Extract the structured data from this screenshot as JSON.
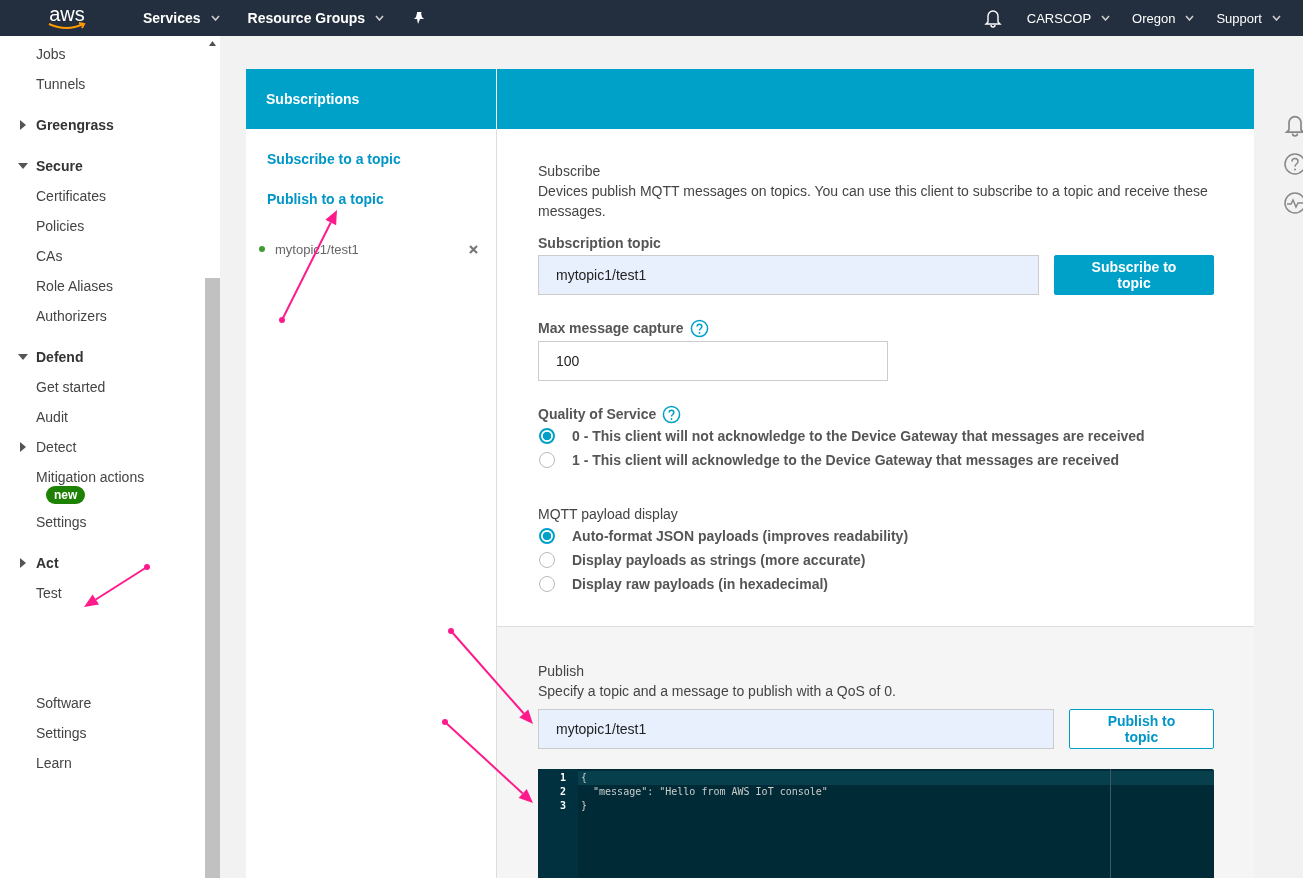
{
  "header": {
    "logo": "aws",
    "menus": [
      {
        "label": "Services"
      },
      {
        "label": "Resource Groups"
      }
    ],
    "account_menus": [
      {
        "label": "CARSCOP"
      },
      {
        "label": "Oregon"
      },
      {
        "label": "Support"
      }
    ]
  },
  "sidebar": {
    "items": [
      {
        "kind": "link",
        "label": "Jobs"
      },
      {
        "kind": "link",
        "label": "Tunnels"
      },
      {
        "kind": "section",
        "label": "Greengrass",
        "expanded": false
      },
      {
        "kind": "section",
        "label": "Secure",
        "expanded": true
      },
      {
        "kind": "link",
        "label": "Certificates"
      },
      {
        "kind": "link",
        "label": "Policies"
      },
      {
        "kind": "link",
        "label": "CAs"
      },
      {
        "kind": "link",
        "label": "Role Aliases"
      },
      {
        "kind": "link",
        "label": "Authorizers"
      },
      {
        "kind": "section",
        "label": "Defend",
        "expanded": true
      },
      {
        "kind": "link",
        "label": "Get started"
      },
      {
        "kind": "link",
        "label": "Audit"
      },
      {
        "kind": "group",
        "label": "Detect",
        "expanded": false
      },
      {
        "kind": "link",
        "label": "Mitigation actions",
        "badge": "new"
      },
      {
        "kind": "link",
        "label": "Settings"
      },
      {
        "kind": "section",
        "label": "Act",
        "expanded": false
      },
      {
        "kind": "link",
        "label": "Test"
      }
    ],
    "footer_items": [
      {
        "label": "Software"
      },
      {
        "label": "Settings"
      },
      {
        "label": "Learn"
      }
    ]
  },
  "panel": {
    "title": "Subscriptions",
    "links": [
      "Subscribe to a topic",
      "Publish to a topic"
    ],
    "subscriptions": [
      {
        "topic": "mytopic1/test1",
        "color": "#3f9c35"
      }
    ]
  },
  "subscribe": {
    "title": "Subscribe",
    "description": "Devices publish MQTT messages on topics. You can use this client to subscribe to a topic and receive these messages.",
    "topic_label": "Subscription topic",
    "topic_value": "mytopic1/test1",
    "button": "Subscribe to topic",
    "max_label": "Max message capture",
    "max_value": "100",
    "qos": {
      "label": "Quality of Service",
      "options": [
        {
          "label": "0 - This client will not acknowledge to the Device Gateway that messages are received",
          "selected": true
        },
        {
          "label": "1 - This client will acknowledge to the Device Gateway that messages are received",
          "selected": false
        }
      ]
    },
    "payload": {
      "label": "MQTT payload display",
      "options": [
        {
          "label": "Auto-format JSON payloads (improves readability)",
          "selected": true
        },
        {
          "label": "Display payloads as strings (more accurate)",
          "selected": false
        },
        {
          "label": "Display raw payloads (in hexadecimal)",
          "selected": false
        }
      ]
    }
  },
  "publish": {
    "title": "Publish",
    "description": "Specify a topic and a message to publish with a QoS of 0.",
    "topic_value": "mytopic1/test1",
    "button": "Publish to topic",
    "editor_lines": [
      {
        "number": "1",
        "text": "{"
      },
      {
        "number": "2",
        "text": "  \"message\": \"Hello from AWS IoT console\""
      },
      {
        "number": "3",
        "text": "}"
      }
    ]
  }
}
